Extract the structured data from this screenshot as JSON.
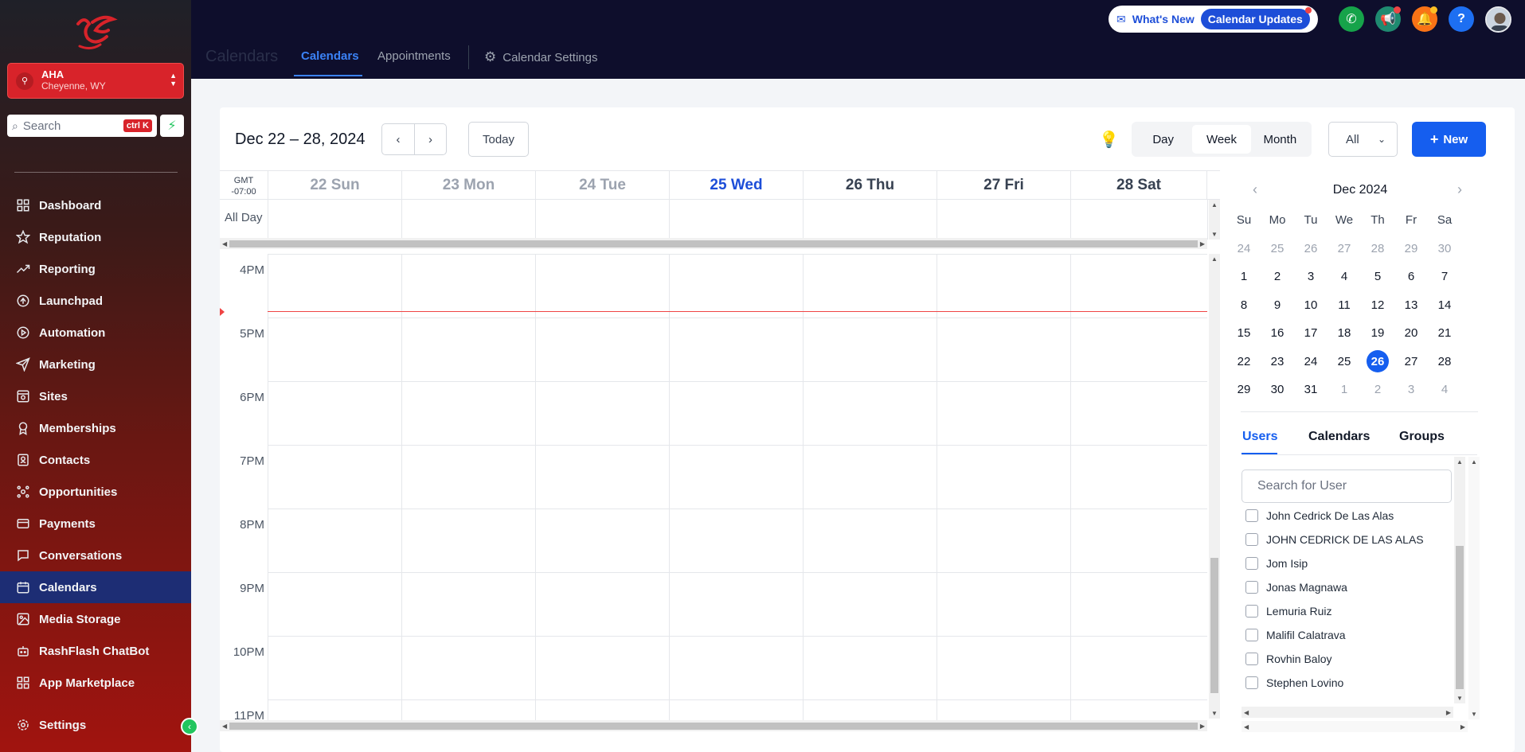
{
  "sidebar": {
    "account": {
      "name": "AHA",
      "location": "Cheyenne, WY"
    },
    "search": {
      "placeholder": "Search",
      "shortcut": "ctrl K"
    },
    "items": [
      {
        "label": "Dashboard",
        "icon": "dashboard-icon"
      },
      {
        "label": "Reputation",
        "icon": "star-icon"
      },
      {
        "label": "Reporting",
        "icon": "trending-icon"
      },
      {
        "label": "Launchpad",
        "icon": "rocket-icon"
      },
      {
        "label": "Automation",
        "icon": "automation-icon"
      },
      {
        "label": "Marketing",
        "icon": "send-icon"
      },
      {
        "label": "Sites",
        "icon": "sites-icon"
      },
      {
        "label": "Memberships",
        "icon": "badge-icon"
      },
      {
        "label": "Contacts",
        "icon": "contacts-icon"
      },
      {
        "label": "Opportunities",
        "icon": "opportunities-icon"
      },
      {
        "label": "Payments",
        "icon": "payments-icon"
      },
      {
        "label": "Conversations",
        "icon": "chat-icon"
      },
      {
        "label": "Calendars",
        "icon": "calendar-icon"
      },
      {
        "label": "Media Storage",
        "icon": "image-icon"
      },
      {
        "label": "RashFlash ChatBot",
        "icon": "bot-icon"
      },
      {
        "label": "App Marketplace",
        "icon": "apps-icon"
      }
    ],
    "active": "Calendars",
    "settings_label": "Settings"
  },
  "header": {
    "crumb": "Calendars",
    "tabs": [
      "Calendars",
      "Appointments",
      "Calendar Settings"
    ],
    "active_tab": "Calendars",
    "whats_new": "What's New",
    "updates": "Calendar Updates"
  },
  "toolbar": {
    "range": "Dec 22 – 28, 2024",
    "today": "Today",
    "views": [
      "Day",
      "Week",
      "Month"
    ],
    "active_view": "Week",
    "filter": "All",
    "new_label": "New"
  },
  "grid": {
    "gmt": [
      "GMT",
      "-07:00"
    ],
    "all_day": "All Day",
    "days": [
      "22 Sun",
      "23 Mon",
      "24 Tue",
      "25 Wed",
      "26 Thu",
      "27 Fri",
      "28 Sat"
    ],
    "hours": [
      "4PM",
      "5PM",
      "6PM",
      "7PM",
      "8PM",
      "9PM",
      "10PM",
      "11PM"
    ]
  },
  "mini_calendar": {
    "title": "Dec 2024",
    "weekdays": [
      "Su",
      "Mo",
      "Tu",
      "We",
      "Th",
      "Fr",
      "Sa"
    ],
    "weeks": [
      [
        "24",
        "25",
        "26",
        "27",
        "28",
        "29",
        "30"
      ],
      [
        "1",
        "2",
        "3",
        "4",
        "5",
        "6",
        "7"
      ],
      [
        "8",
        "9",
        "10",
        "11",
        "12",
        "13",
        "14"
      ],
      [
        "15",
        "16",
        "17",
        "18",
        "19",
        "20",
        "21"
      ],
      [
        "22",
        "23",
        "24",
        "25",
        "26",
        "27",
        "28"
      ],
      [
        "29",
        "30",
        "31",
        "1",
        "2",
        "3",
        "4"
      ]
    ],
    "selected": "26"
  },
  "panel": {
    "tabs": [
      "Users",
      "Calendars",
      "Groups"
    ],
    "active_tab": "Users",
    "search_placeholder": "Search for User",
    "users": [
      "John Cedrick De Las Alas",
      "JOHN CEDRICK DE LAS ALAS",
      "Jom Isip",
      "Jonas Magnawa",
      "Lemuria Ruiz",
      "Malifil Calatrava",
      "Rovhin Baloy",
      "Stephen Lovino"
    ]
  },
  "colors": {
    "accent": "#155eef",
    "brand_red": "#d8232a",
    "now_line": "#ef4444"
  }
}
